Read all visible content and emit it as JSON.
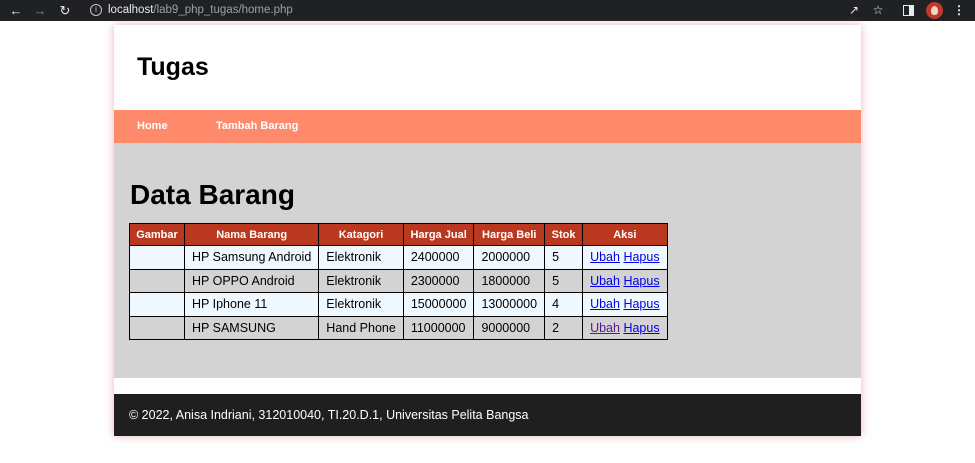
{
  "browser": {
    "url_host": "localhost",
    "url_path": "/lab9_php_tugas/home.php",
    "icons": [
      "back-icon",
      "forward-icon",
      "reload-icon",
      "info-icon",
      "share-icon",
      "star-icon",
      "side-panel-icon",
      "avatar",
      "menu-icon"
    ]
  },
  "header": {
    "title": "Tugas"
  },
  "nav": {
    "home": "Home",
    "add": "Tambah Barang"
  },
  "main": {
    "heading": "Data Barang",
    "table": {
      "headers": [
        "Gambar",
        "Nama Barang",
        "Katagori",
        "Harga Jual",
        "Harga Beli",
        "Stok",
        "Aksi"
      ],
      "rows": [
        {
          "gambar": "",
          "nama": "HP Samsung Android",
          "kategori": "Elektronik",
          "harga_jual": "2400000",
          "harga_beli": "2000000",
          "stok": "5",
          "ubah": "Ubah",
          "hapus": "Hapus"
        },
        {
          "gambar": "",
          "nama": "HP OPPO Android",
          "kategori": "Elektronik",
          "harga_jual": "2300000",
          "harga_beli": "1800000",
          "stok": "5",
          "ubah": "Ubah",
          "hapus": "Hapus"
        },
        {
          "gambar": "",
          "nama": "HP Iphone 11",
          "kategori": "Elektronik",
          "harga_jual": "15000000",
          "harga_beli": "13000000",
          "stok": "4",
          "ubah": "Ubah",
          "hapus": "Hapus"
        },
        {
          "gambar": "",
          "nama": "HP SAMSUNG",
          "kategori": "Hand Phone",
          "harga_jual": "11000000",
          "harga_beli": "9000000",
          "stok": "2",
          "ubah": "Ubah",
          "hapus": "Hapus"
        }
      ]
    }
  },
  "footer": {
    "text": "© 2022, Anisa Indriani, 312010040, TI.20.D.1, Universitas Pelita Bangsa"
  },
  "colors": {
    "nav_bg": "#ff8a6b",
    "table_header": "#b9381f",
    "main_bg": "#d3d3d3",
    "footer_bg": "#1f1f1f",
    "row_alt": "#f0f8ff"
  }
}
